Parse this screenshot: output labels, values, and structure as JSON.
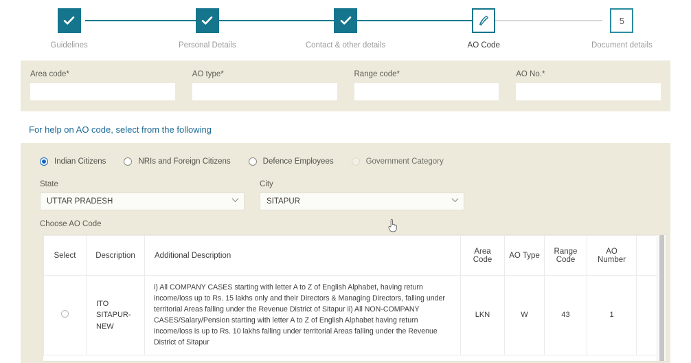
{
  "stepper": {
    "steps": [
      {
        "label": "Guidelines",
        "state": "done",
        "icon": "check-icon",
        "num": "1"
      },
      {
        "label": "Personal Details",
        "state": "done",
        "icon": "check-icon",
        "num": "2"
      },
      {
        "label": "Contact & other details",
        "state": "done",
        "icon": "check-icon",
        "num": "3"
      },
      {
        "label": "AO Code",
        "state": "current",
        "icon": "pencil-icon",
        "num": "4"
      },
      {
        "label": "Document details",
        "state": "future",
        "icon": "number",
        "num": "5"
      }
    ]
  },
  "code_fields": [
    {
      "label": "Area code*",
      "value": "",
      "placeholder": ""
    },
    {
      "label": "AO type*",
      "value": "",
      "placeholder": ""
    },
    {
      "label": "Range code*",
      "value": "",
      "placeholder": ""
    },
    {
      "label": "AO No.*",
      "value": "",
      "placeholder": ""
    }
  ],
  "help": {
    "heading": "For help on AO code, select from the following",
    "categories": [
      {
        "label": "Indian Citizens",
        "selected": true,
        "faded": false
      },
      {
        "label": "NRIs and Foreign Citizens",
        "selected": false,
        "faded": false
      },
      {
        "label": "Defence Employees",
        "selected": false,
        "faded": false
      },
      {
        "label": "Government Category",
        "selected": false,
        "faded": true
      }
    ],
    "state": {
      "label": "State",
      "value": "UTTAR PRADESH"
    },
    "city": {
      "label": "City",
      "value": "SITAPUR"
    },
    "choose_label": "Choose AO Code"
  },
  "table": {
    "headers": [
      "Select",
      "Description",
      "Additional Description",
      "Area Code",
      "AO Type",
      "Range Code",
      "AO Number"
    ],
    "rows": [
      {
        "select": "",
        "description": "ITO SITAPUR-NEW",
        "additional_description": "i) All COMPANY CASES starting with letter A to Z of English Alphabet, having return income/loss up to Rs. 15 lakhs only and their Directors & Managing Directors, falling under territorial Areas falling under the Revenue District of Sitapur ii) All NON-COMPANY CASES/Salary/Pension starting with letter A to Z of English Alphabet having return income/loss is up to Rs. 10 lakhs falling under territorial Areas falling under the Revenue District of Sitapur",
        "area_code": "LKN",
        "ao_type": "W",
        "range_code": "43",
        "ao_number": "1"
      }
    ]
  },
  "colors": {
    "teal": "#15758c",
    "beige": "#edeadb",
    "link_blue": "#1d6a93",
    "radio_blue": "#1565c0"
  }
}
